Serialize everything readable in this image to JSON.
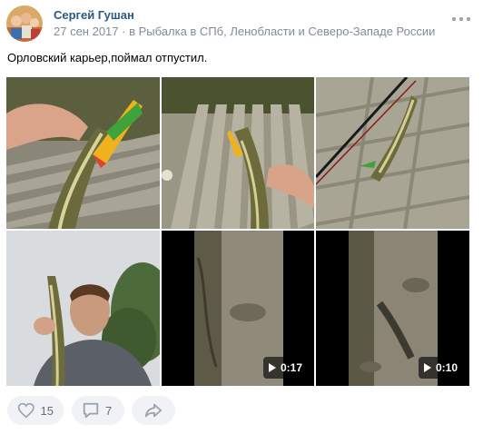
{
  "post": {
    "author": "Сергей Гушан",
    "date": "27 сен 2017",
    "group_prefix": "в",
    "group": "Рыбалка в СПб, Ленобласти и Северо-Западе России",
    "text": "Орловский карьер,поймал отпустил.",
    "more_icon": "more-dots-icon"
  },
  "media": [
    {
      "kind": "photo",
      "alt": "photo-1"
    },
    {
      "kind": "photo",
      "alt": "photo-2"
    },
    {
      "kind": "photo",
      "alt": "photo-3"
    },
    {
      "kind": "photo",
      "alt": "photo-4"
    },
    {
      "kind": "video",
      "duration": "0:17"
    },
    {
      "kind": "video",
      "duration": "0:10"
    }
  ],
  "actions": {
    "likes": "15",
    "comments": "7",
    "like_icon": "heart-icon",
    "comment_icon": "comment-icon",
    "share_icon": "share-icon"
  },
  "colors": {
    "author_link": "#2a5885",
    "meta_text": "#818c99",
    "action_bg": "#f0f2f5",
    "action_text": "#626d7a"
  }
}
